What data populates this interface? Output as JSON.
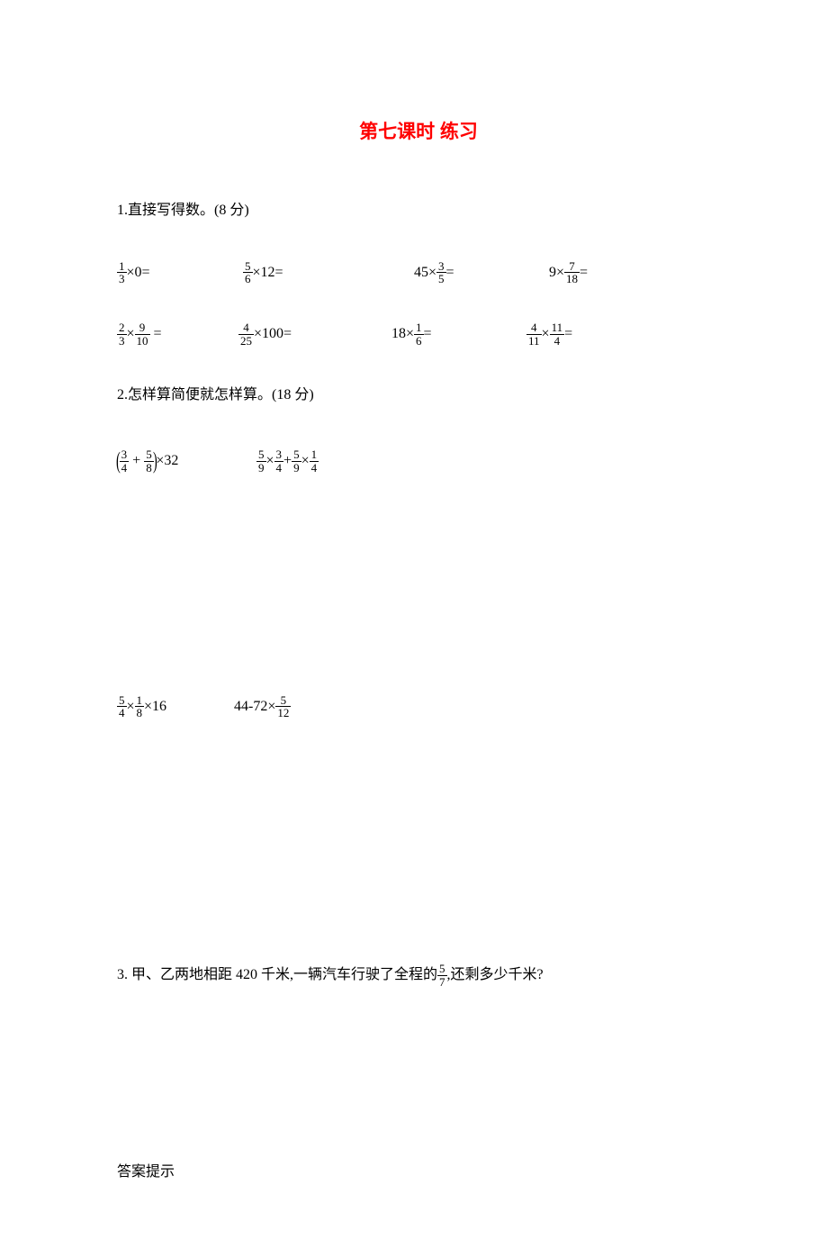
{
  "title": "第七课时 练习",
  "q1": {
    "head": "1.直接写得数。(8 分)",
    "row1": [
      {
        "pre": "",
        "n1": "1",
        "d1": "3",
        "op": "×",
        "tail": "0="
      },
      {
        "pre": "",
        "n1": "5",
        "d1": "6",
        "op": "×",
        "tail": "12="
      },
      {
        "pre": "45×",
        "n1": "3",
        "d1": "5",
        "op": "",
        "tail": "="
      },
      {
        "pre": "9×",
        "n1": "7",
        "d1": "18",
        "op": "",
        "tail": "="
      }
    ],
    "row2": [
      {
        "n1": "2",
        "d1": "3",
        "n2": "9",
        "d2": "10",
        "tail": " ="
      },
      {
        "n1": "4",
        "d1": "25",
        "tail": "×100="
      },
      {
        "pre": "18×",
        "n1": "1",
        "d1": "6",
        "tail": "="
      },
      {
        "n1": "4",
        "d1": "11",
        "n2": "11",
        "d2": "4",
        "tail": "="
      }
    ]
  },
  "q2": {
    "head": "2.怎样算简便就怎样算。(18 分)",
    "expr1": {
      "lp": "(",
      "n1": "3",
      "d1": "4",
      "plus": " + ",
      "n2": "5",
      "d2": "8",
      "rp": ")",
      "tail": "×32"
    },
    "expr2": {
      "n1": "5",
      "d1": "9",
      "n2": "3",
      "d2": "4",
      "n3": "5",
      "d3": "9",
      "n4": "1",
      "d4": "4"
    },
    "expr3": {
      "n1": "5",
      "d1": "4",
      "n2": "1",
      "d2": "8",
      "tail": "×16"
    },
    "expr4": {
      "pre": "44-72×",
      "n1": "5",
      "d1": "12"
    }
  },
  "q3": {
    "a": "3. 甲、乙两地相距 420 千米,一辆汽车行驶了全程的",
    "n": "5",
    "d": "7",
    "b": ",还剩多少千米?"
  },
  "ans": "答案提示"
}
